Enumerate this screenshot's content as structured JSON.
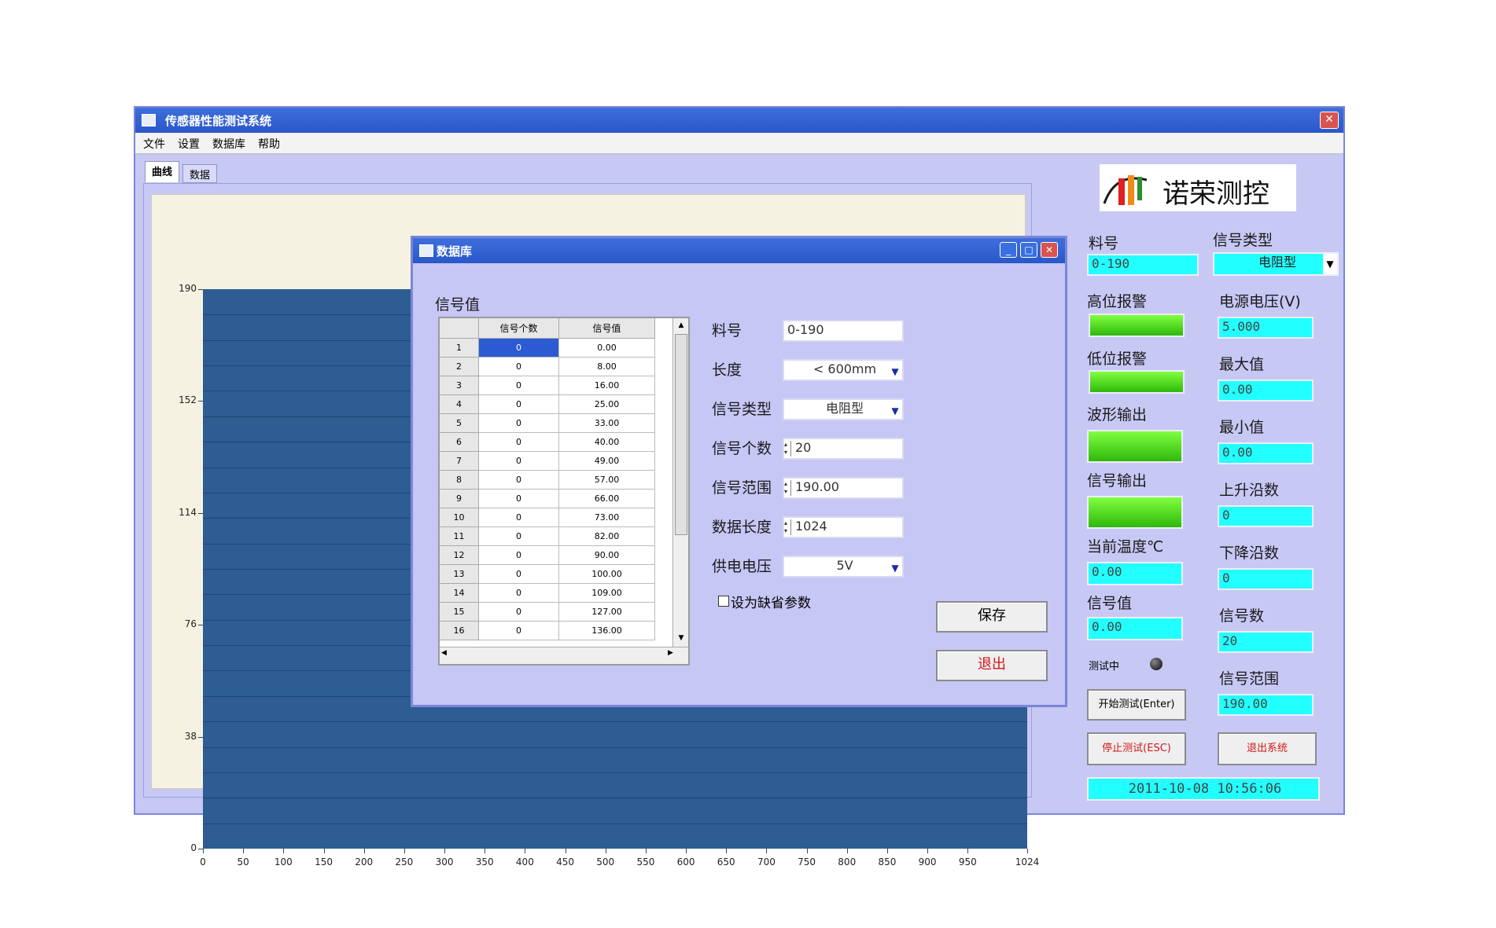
{
  "window": {
    "title": "传感器性能测试系统",
    "close_glyph": "✕"
  },
  "menu": [
    "文件",
    "设置",
    "数据库",
    "帮助"
  ],
  "tabs": [
    "曲线",
    "数据"
  ],
  "chart_data": {
    "type": "line",
    "y_ticks": [
      "190",
      "152",
      "114",
      "76",
      "38",
      "0"
    ],
    "x_ticks": [
      "0",
      "50",
      "100",
      "150",
      "200",
      "250",
      "300",
      "350",
      "400",
      "450",
      "500",
      "550",
      "600",
      "650",
      "700",
      "750",
      "800",
      "850",
      "900",
      "950",
      "1024"
    ],
    "xlim": [
      0,
      1024
    ],
    "ylim": [
      0,
      190
    ],
    "grid": true,
    "background_color": "#2d5d92"
  },
  "logo": {
    "text": "诺荣测控"
  },
  "right_panel": {
    "liaohao_label": "料号",
    "liaohao_value": "0-190",
    "signal_type_label": "信号类型",
    "signal_type_value": "电阻型",
    "high_alarm_label": "高位报警",
    "low_alarm_label": "低位报警",
    "wave_output_label": "波形输出",
    "signal_output_label": "信号输出",
    "cur_temp_label": "当前温度℃",
    "cur_temp_value": "0.00",
    "signal_value_label": "信号值",
    "signal_value_value": "0.00",
    "testing_label": "测试中",
    "power_voltage_label": "电源电压(V)",
    "power_voltage_value": "5.000",
    "max_label": "最大值",
    "max_value": "0.00",
    "min_label": "最小值",
    "min_value": "0.00",
    "rise_label": "上升沿数",
    "rise_value": "0",
    "fall_label": "下降沿数",
    "fall_value": "0",
    "count_label": "信号数",
    "count_value": "20",
    "range_label": "信号范围",
    "range_value": "190.00",
    "start_button": "开始测试(Enter)",
    "stop_button": "停止测试(ESC)",
    "exit_button": "退出系统",
    "datetime": "2011-10-08   10:56:06"
  },
  "dialog": {
    "title": "数据库",
    "group_label": "信号值",
    "grid_headers": [
      "信号个数",
      "信号值"
    ],
    "rows": [
      {
        "n": "1",
        "count": "0",
        "value": "0.00"
      },
      {
        "n": "2",
        "count": "0",
        "value": "8.00"
      },
      {
        "n": "3",
        "count": "0",
        "value": "16.00"
      },
      {
        "n": "4",
        "count": "0",
        "value": "25.00"
      },
      {
        "n": "5",
        "count": "0",
        "value": "33.00"
      },
      {
        "n": "6",
        "count": "0",
        "value": "40.00"
      },
      {
        "n": "7",
        "count": "0",
        "value": "49.00"
      },
      {
        "n": "8",
        "count": "0",
        "value": "57.00"
      },
      {
        "n": "9",
        "count": "0",
        "value": "66.00"
      },
      {
        "n": "10",
        "count": "0",
        "value": "73.00"
      },
      {
        "n": "11",
        "count": "0",
        "value": "82.00"
      },
      {
        "n": "12",
        "count": "0",
        "value": "90.00"
      },
      {
        "n": "13",
        "count": "0",
        "value": "100.00"
      },
      {
        "n": "14",
        "count": "0",
        "value": "109.00"
      },
      {
        "n": "15",
        "count": "0",
        "value": "127.00"
      },
      {
        "n": "16",
        "count": "0",
        "value": "136.00"
      }
    ],
    "liaohao_label": "料号",
    "liaohao_value": "0-190",
    "length_label": "长度",
    "length_value": "< 600mm",
    "signal_type_label": "信号类型",
    "signal_type_value": "电阻型",
    "signal_count_label": "信号个数",
    "signal_count_value": "20",
    "signal_range_label": "信号范围",
    "signal_range_value": "190.00",
    "data_length_label": "数据长度",
    "data_length_value": "1024",
    "supply_voltage_label": "供电电压",
    "supply_voltage_value": "5V",
    "default_checkbox_label": "设为缺省参数",
    "save_button": "保存",
    "exit_button": "退出"
  }
}
